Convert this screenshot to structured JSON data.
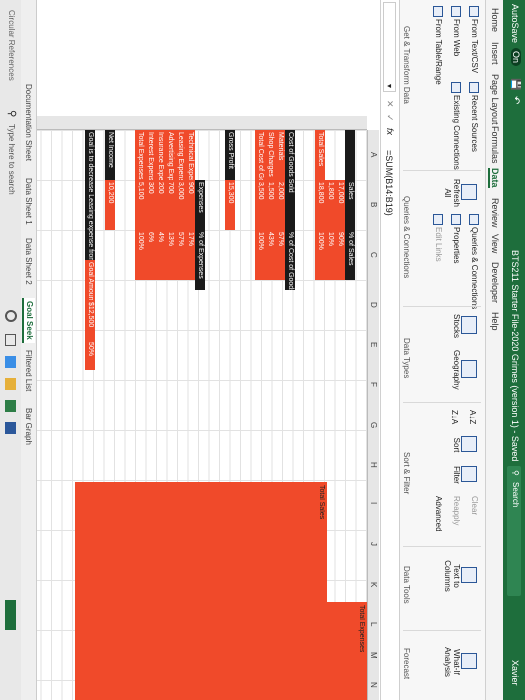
{
  "titlebar": {
    "autosave": "AutoSave",
    "autosave_state": "On",
    "file_title": "BTS211 Starter File-2020 Grimes (version 1) - Saved",
    "search": "Search",
    "user": "Xavier"
  },
  "tabs": [
    "Home",
    "Insert",
    "Page Layout",
    "Formulas",
    "Data",
    "Review",
    "View",
    "Developer",
    "Help"
  ],
  "ribbon": {
    "get_transform": {
      "items": [
        "From Text/CSV",
        "From Web",
        "From Table/Range"
      ],
      "recent": [
        "Recent Sources",
        "Existing Connections"
      ],
      "label": "Get & Transform Data"
    },
    "queries": {
      "items": [
        "Queries & Connections",
        "Properties",
        "Edit Links"
      ],
      "refresh": "Refresh All",
      "label": "Queries & Connections"
    },
    "data_types": {
      "items": [
        "Stocks",
        "Geography"
      ],
      "label": "Data Types"
    },
    "sort_filter": {
      "sort": "Sort",
      "filter": "Filter",
      "extras": [
        "Clear",
        "Reapply",
        "Advanced"
      ],
      "label": "Sort & Filter"
    },
    "data_tools": {
      "items": [
        "Text to Columns"
      ],
      "label": "Data Tools"
    },
    "forecast": {
      "items": [
        "What-If Analysis"
      ],
      "label": "Forecast"
    }
  },
  "formula_bar": {
    "name_box": "",
    "formula": "=SUM(B14:B19)"
  },
  "columns": [
    "A",
    "B",
    "C",
    "D",
    "E",
    "F",
    "G",
    "H",
    "I",
    "J",
    "K",
    "L",
    "M",
    "N"
  ],
  "sheet": {
    "header_sales": "Sales",
    "header_pct_sales": "% of Sales",
    "sales_rows": [
      {
        "label": "",
        "value": "17,000",
        "pct": "90%"
      },
      {
        "label": "",
        "value": "1,800",
        "pct": "10%"
      },
      {
        "label": "Total Sales",
        "value": "18,800",
        "pct": "100%"
      }
    ],
    "cogs_header": "Cost of Goods Sold",
    "cogs_pct_header": "% of Cost of Goods",
    "cogs_rows": [
      {
        "label": "Materials",
        "value": "2,000",
        "pct": "57%"
      },
      {
        "label": "Shop Charges",
        "value": "1,500",
        "pct": "43%"
      },
      {
        "label": "Total Cost of Goods Sold",
        "value": "3,500",
        "pct": "100%"
      }
    ],
    "gross_profit": "Gross Profit",
    "gross_profit_value": "15,300",
    "expenses_header": "Expenses",
    "expenses_pct_header": "% of Expenses",
    "expense_rows": [
      {
        "label": "Technical Expenses",
        "value": "900",
        "pct": "17%"
      },
      {
        "label": "Leasing Expenses",
        "value": "3,000",
        "pct": "57%"
      },
      {
        "label": "Advertising Expenses",
        "value": "700",
        "pct": "13%"
      },
      {
        "label": "Insurance Expenses",
        "value": "200",
        "pct": "4%"
      },
      {
        "label": "Interest Expenses",
        "value": "300",
        "pct": "6%"
      },
      {
        "label": "Total Expenses",
        "value": "5,100",
        "pct": "100%"
      }
    ],
    "net_income": "Net Income",
    "net_income_value": "10,200",
    "goal_text": "Goal is to decrease Leasing expense from 58% to 50%",
    "goal_amount_label": "Goal Amount",
    "goal_value": "$12,500",
    "goal_pct": "50%",
    "chart_label_total_sales": "Total Sales",
    "chart_label_total_expenses": "Total Expenses"
  },
  "sheet_tabs": [
    "Documentation Sheet",
    "Data Sheet 1",
    "Data Sheet 2",
    "Goal Seek",
    "Filtered List",
    "Bar Graph"
  ],
  "status": {
    "left": "Circular References",
    "search_placeholder": "Type here to search"
  },
  "colors": {
    "excel_green": "#1e6e3c",
    "highlight_red": "#f04a2a",
    "label_black": "#1a1a1a"
  }
}
